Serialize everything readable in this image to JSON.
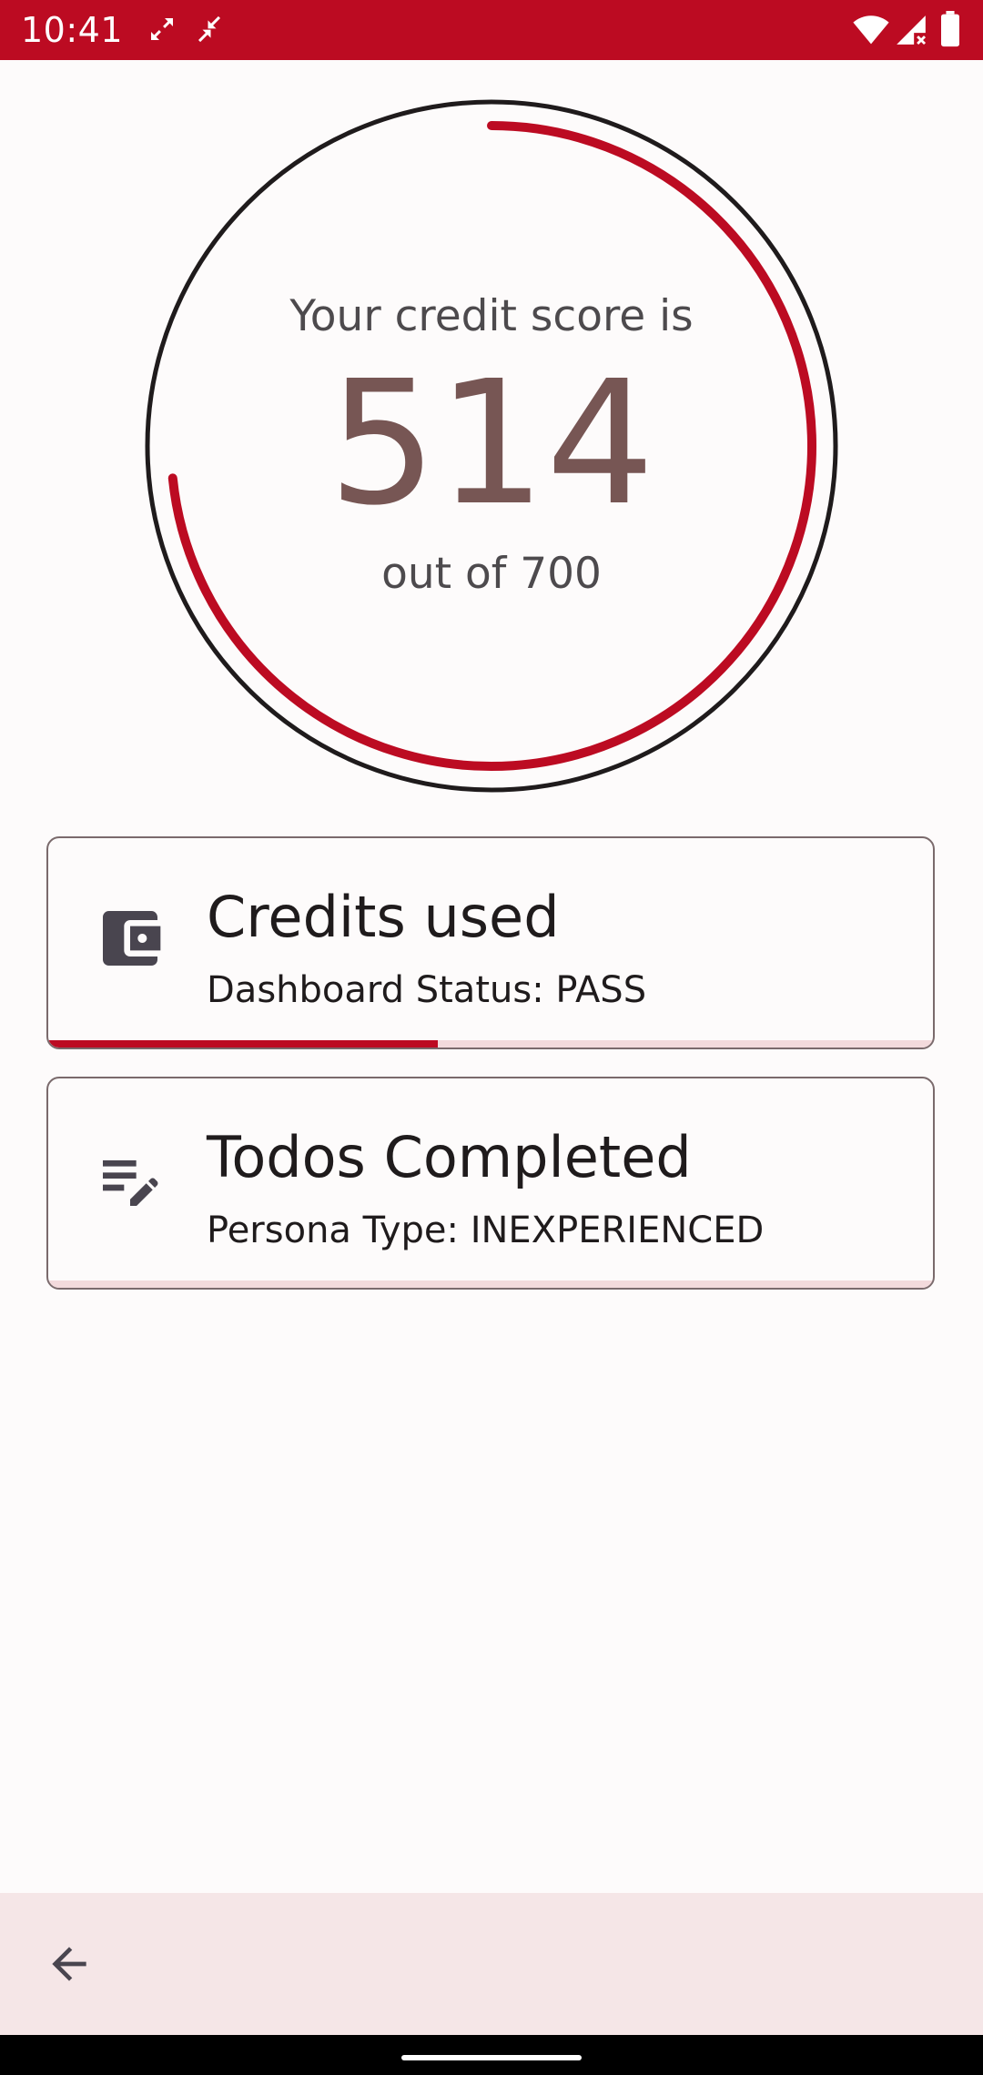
{
  "status_bar": {
    "time": "10:41",
    "icons": [
      "expand-arrows-icon",
      "compress-arrows-icon",
      "wifi-icon",
      "signal-icon",
      "battery-icon"
    ],
    "background_color": "#bc0b22"
  },
  "score_gauge": {
    "caption": "Your credit score is",
    "score": "514",
    "out_of": "out of 700",
    "progress_fraction": 0.734,
    "arc_color": "#bc0b22",
    "score_color": "#775654"
  },
  "cards": [
    {
      "title": "Credits used",
      "subtitle": "Dashboard Status: PASS",
      "icon": "wallet-icon",
      "progress_fraction": 0.44
    },
    {
      "title": "Todos Completed",
      "subtitle": "Persona Type: INEXPERIENCED",
      "icon": "edit-list-icon",
      "progress_fraction": 0.0
    }
  ],
  "bottom_bar": {
    "back_icon": "arrow-back-icon"
  },
  "accent_color": "#bc0b22"
}
